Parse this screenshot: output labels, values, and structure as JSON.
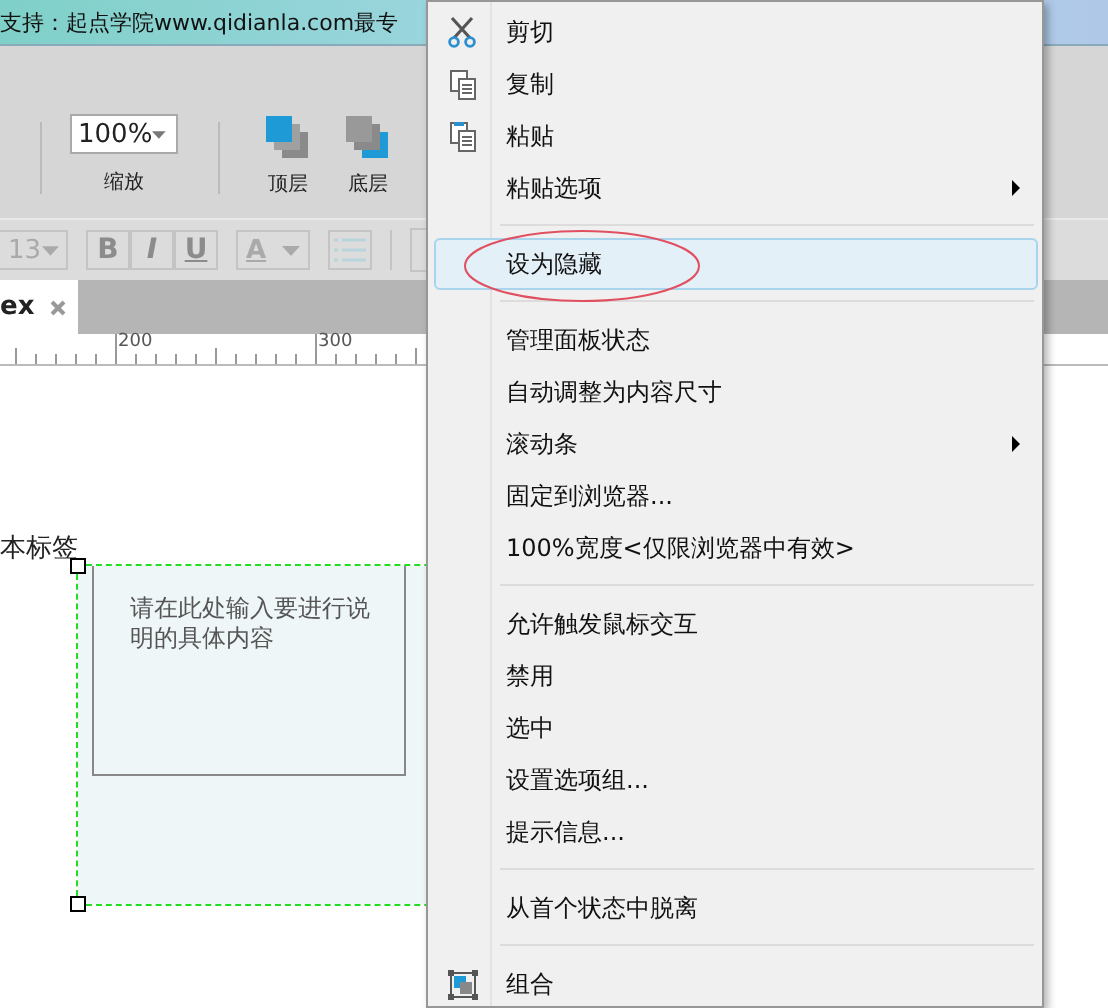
{
  "window": {
    "title": "支持：起点学院www.qidianla.com最专"
  },
  "toolbar": {
    "zoom": {
      "value": "100%",
      "label": "缩放"
    },
    "buttons": [
      {
        "kind": "top",
        "label": "顶层"
      },
      {
        "kind": "bottom",
        "label": "底层"
      }
    ]
  },
  "format_bar": {
    "font_size": "13",
    "styles": [
      "B",
      "I",
      "U"
    ],
    "font_color": "A"
  },
  "tabs": [
    {
      "label": "ex",
      "selected": true
    }
  ],
  "ruler": {
    "labels": [
      "200",
      "300"
    ]
  },
  "canvas": {
    "label": "本标签",
    "note": {
      "text": "请在此处输入要进行说明的具体内容",
      "selected": true
    }
  },
  "context_menu": {
    "groups": [
      [
        {
          "kind": "cut",
          "label": "剪切",
          "selected": false,
          "circled": false
        },
        {
          "kind": "copy",
          "label": "复制",
          "selected": false,
          "circled": false
        },
        {
          "kind": "paste",
          "label": "粘贴",
          "selected": false,
          "circled": false
        },
        {
          "kind": "submenu",
          "label": "粘贴选项",
          "selected": false,
          "circled": false
        }
      ],
      [
        {
          "kind": "plain",
          "label": "设为隐藏",
          "selected": true,
          "circled": true
        }
      ],
      [
        {
          "kind": "plain",
          "label": "管理面板状态",
          "selected": false,
          "circled": false
        },
        {
          "kind": "plain",
          "label": "自动调整为内容尺寸",
          "selected": false,
          "circled": false
        },
        {
          "kind": "submenu",
          "label": "滚动条",
          "selected": false,
          "circled": false
        },
        {
          "kind": "plain",
          "label": "固定到浏览器...",
          "selected": false,
          "circled": false
        },
        {
          "kind": "plain",
          "label": "100%宽度<仅限浏览器中有效>",
          "selected": false,
          "circled": false
        }
      ],
      [
        {
          "kind": "plain",
          "label": "允许触发鼠标交互",
          "selected": false,
          "circled": false
        },
        {
          "kind": "plain",
          "label": "禁用",
          "selected": false,
          "circled": false
        },
        {
          "kind": "plain",
          "label": "选中",
          "selected": false,
          "circled": false
        },
        {
          "kind": "plain",
          "label": "设置选项组...",
          "selected": false,
          "circled": false
        },
        {
          "kind": "plain",
          "label": "提示信息...",
          "selected": false,
          "circled": false
        }
      ],
      [
        {
          "kind": "plain",
          "label": "从首个状态中脱离",
          "selected": false,
          "circled": false
        }
      ],
      [
        {
          "kind": "group",
          "label": "组合",
          "selected": false,
          "circled": false
        }
      ]
    ]
  }
}
